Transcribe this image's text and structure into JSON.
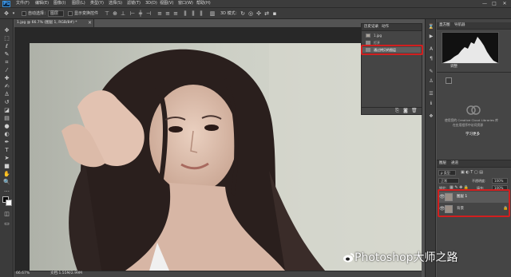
{
  "app": {
    "logo": "Ps"
  },
  "menu": [
    "文件(F)",
    "编辑(E)",
    "图像(I)",
    "图层(L)",
    "类型(Y)",
    "选择(S)",
    "滤镜(T)",
    "3D(D)",
    "视图(V)",
    "窗口(W)",
    "帮助(H)"
  ],
  "window_controls": {
    "minimize": "—",
    "maximize": "□",
    "close": "✕"
  },
  "options": {
    "auto_select_label": "自动选择：",
    "auto_select_value": "图层",
    "show_transform_label": "显示变换控件",
    "mode_3d_label": "3D 模式："
  },
  "document": {
    "tab_title": "1.jpg @ 66.7% (图层 1, RGB/8#) *",
    "close": "×"
  },
  "status": {
    "zoom": "66.67%",
    "doc_size": "文档:1.55M/2.99M"
  },
  "history": {
    "tabs": [
      "历史记录",
      "动作"
    ],
    "rows": [
      {
        "label": "1.jpg"
      },
      {
        "label": "打开"
      },
      {
        "label": "通过拷贝的图层"
      }
    ]
  },
  "histogram": {
    "tabs": [
      "直方图",
      "导航器"
    ],
    "source_label": "调整"
  },
  "adjustments": {
    "message": "使用您的 Creative Cloud Libraries 库",
    "message2": "在应用程序中访问资源",
    "button": "学习更多"
  },
  "layers": {
    "tabs": [
      "图层",
      "通道"
    ],
    "kind_label": "ρ 类型",
    "blend_mode": "正常",
    "opacity_label": "不透明度:",
    "opacity_value": "100%",
    "lock_label": "锁定:",
    "fill_label": "填充:",
    "fill_value": "100%",
    "rows": [
      {
        "name": "图层 1"
      },
      {
        "name": "背景"
      }
    ]
  },
  "watermark": {
    "text": "Photoshop大师之路"
  },
  "colors": {
    "highlight_box": "#d21f1f",
    "panel": "#454545",
    "bar": "#3b3b3b"
  }
}
